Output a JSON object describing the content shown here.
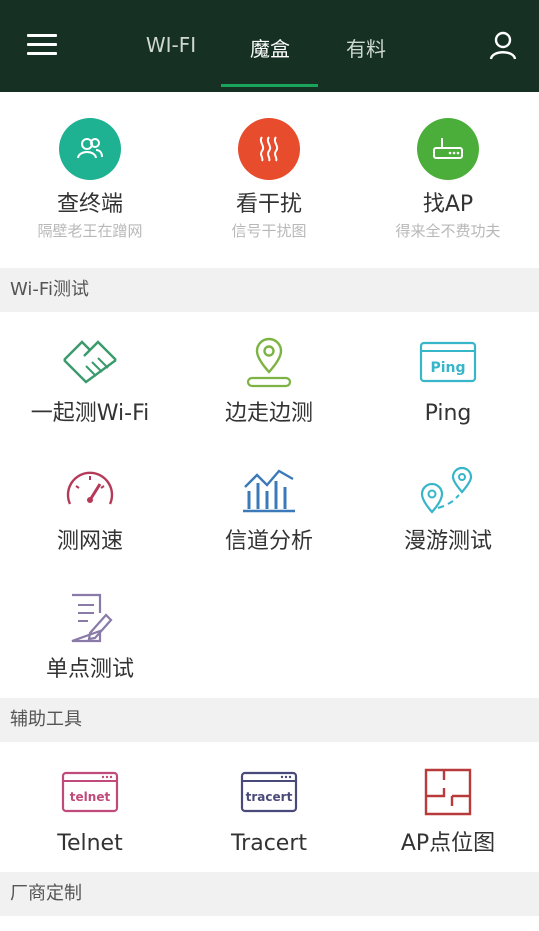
{
  "header": {
    "tabs": [
      {
        "label": "WI-FI",
        "active": false
      },
      {
        "label": "魔盒",
        "active": true
      },
      {
        "label": "有料",
        "active": false
      }
    ],
    "accent_color": "#1aa35a",
    "bg_color": "#163023"
  },
  "features": [
    {
      "title": "查终端",
      "subtitle": "隔壁老王在蹭网",
      "icon": "users-icon",
      "color": "#1eb292"
    },
    {
      "title": "看干扰",
      "subtitle": "信号干扰图",
      "icon": "heat-waves-icon",
      "color": "#e74c2c"
    },
    {
      "title": "找AP",
      "subtitle": "得来全不费功夫",
      "icon": "router-icon",
      "color": "#4cae3a"
    }
  ],
  "sections": {
    "wifi_test": "Wi-Fi测试",
    "tools": "辅助工具",
    "vendor": "厂商定制"
  },
  "wifi_tests": [
    {
      "label": "一起测Wi-Fi",
      "icon": "handshake-icon",
      "color": "#3a9a6c"
    },
    {
      "label": "边走边测",
      "icon": "location-pin-icon",
      "color": "#7cb342"
    },
    {
      "label": "Ping",
      "icon": "ping-window-icon",
      "color": "#36b6c8",
      "icon_text": "Ping"
    },
    {
      "label": "测网速",
      "icon": "speedometer-icon",
      "color": "#b53a59"
    },
    {
      "label": "信道分析",
      "icon": "channel-chart-icon",
      "color": "#3c79b8"
    },
    {
      "label": "漫游测试",
      "icon": "roaming-pins-icon",
      "color": "#36b6c8"
    },
    {
      "label": "单点测试",
      "icon": "document-edit-icon",
      "color": "#8a7aa8"
    }
  ],
  "tools": [
    {
      "label": "Telnet",
      "icon": "telnet-window-icon",
      "color": "#c04a7a",
      "icon_text": "telnet"
    },
    {
      "label": "Tracert",
      "icon": "tracert-window-icon",
      "color": "#4a4a7a",
      "icon_text": "tracert"
    },
    {
      "label": "AP点位图",
      "icon": "floorplan-icon",
      "color": "#b83a3a"
    }
  ]
}
